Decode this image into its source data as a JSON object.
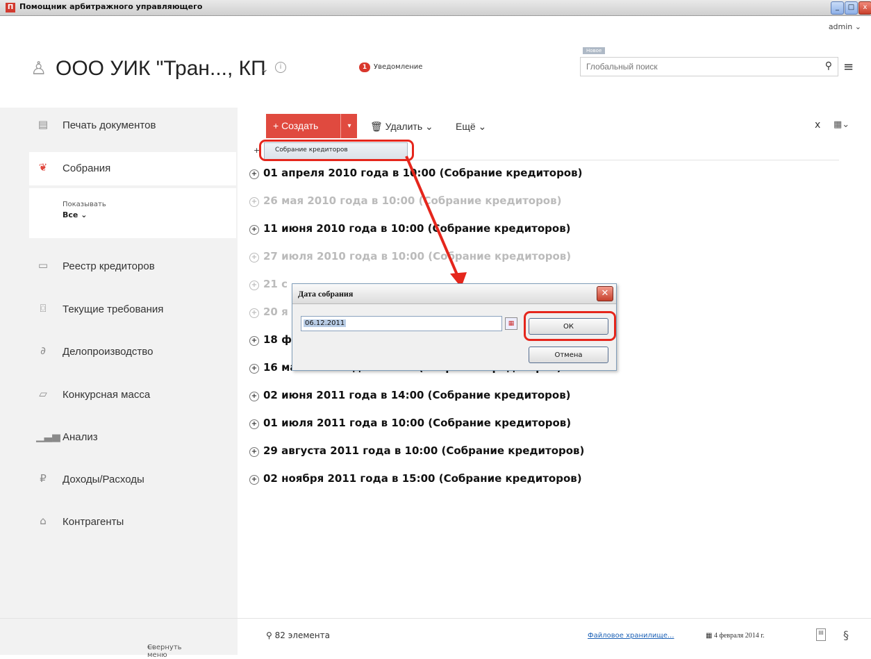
{
  "window": {
    "title": "Помощник арбитражного управляющего",
    "icon_glyph": "П"
  },
  "header": {
    "user": "admin",
    "company": "ООО УИК \"Тран..., КП",
    "notification_count": "1",
    "notification_label": "Уведомление",
    "search_tag": "Новое",
    "search_placeholder": "Глобальный поиск"
  },
  "sidebar": {
    "items": [
      {
        "label": "Печать документов",
        "icon": "print-documents-icon"
      },
      {
        "label": "Собрания",
        "icon": "meetings-handshake-icon",
        "active": true
      },
      {
        "label": "Реестр кредиторов",
        "icon": "registry-icon"
      },
      {
        "label": "Текущие требования",
        "icon": "requirements-icon"
      },
      {
        "label": "Делопроизводство",
        "icon": "paperclip-icon"
      },
      {
        "label": "Конкурсная масса",
        "icon": "mass-icon"
      },
      {
        "label": "Анализ",
        "icon": "analysis-chart-icon"
      },
      {
        "label": "Доходы/Расходы",
        "icon": "ruble-icon"
      },
      {
        "label": "Контрагенты",
        "icon": "bank-icon"
      }
    ],
    "filter": {
      "label": "Показывать",
      "value": "Все"
    }
  },
  "toolbar": {
    "create": "+ Создать",
    "delete": "Удалить",
    "more": "Ещё",
    "close": "x"
  },
  "create_menu": {
    "item": "Собрание кредиторов"
  },
  "meetings": [
    {
      "text": "01 апреля 2010 года в 10:00 (Собрание кредиторов)",
      "past": false
    },
    {
      "text": "26 мая 2010 года в 10:00 (Собрание кредиторов)",
      "past": true
    },
    {
      "text": "11 июня 2010 года в 10:00 (Собрание кредиторов)",
      "past": false
    },
    {
      "text": "27 июля 2010 года в 10:00 (Собрание кредиторов)",
      "past": true
    },
    {
      "text": "21 с",
      "past": true
    },
    {
      "text": "20 я",
      "past": true
    },
    {
      "text": "18 ф",
      "past": false
    },
    {
      "text": "16 мая 2011 года в 14:00 (Собрание кредиторов)",
      "past": false
    },
    {
      "text": "02 июня 2011 года в 14:00 (Собрание кредиторов)",
      "past": false
    },
    {
      "text": "01 июля 2011 года в 10:00 (Собрание кредиторов)",
      "past": false
    },
    {
      "text": "29 августа 2011 года в 10:00 (Собрание кредиторов)",
      "past": false
    },
    {
      "text": "02 ноября 2011 года в 15:00 (Собрание кредиторов)",
      "past": false
    }
  ],
  "dialog": {
    "title": "Дата собрания",
    "date_value": "06.12.2011",
    "ok": "ОК",
    "cancel": "Отмена"
  },
  "footer": {
    "collapse": "Свернуть меню",
    "count": "82 элемента",
    "storage_link": "Файловое хранилище...",
    "date": "4 февраля 2014 г."
  },
  "colors": {
    "accent": "#e04a3f",
    "annotation": "#e5261c",
    "sidebar_bg": "#f2f2f2",
    "past_text": "#bbbbbb"
  }
}
